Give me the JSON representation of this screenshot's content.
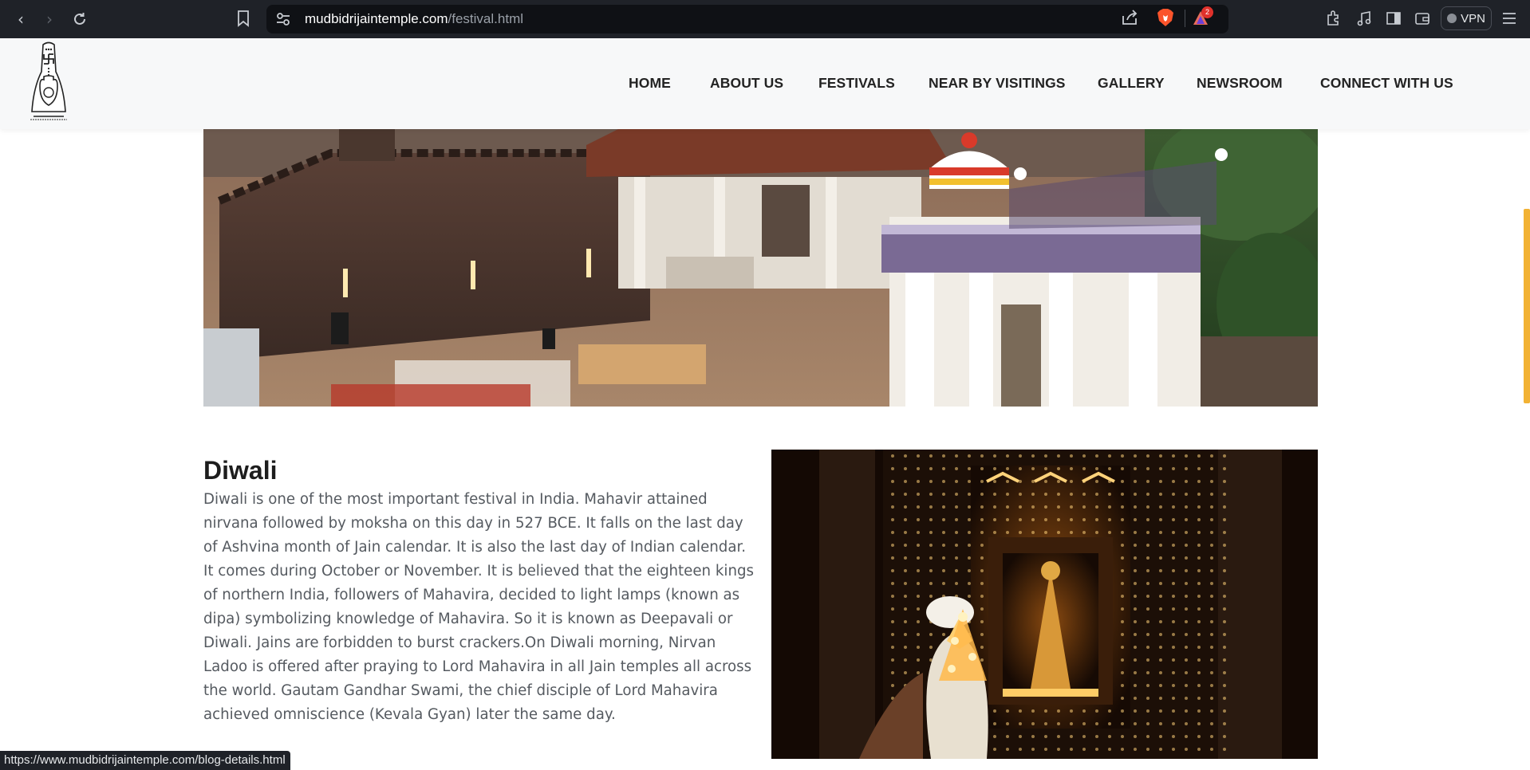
{
  "browser": {
    "url_domain": "mudbidrijaintemple.com",
    "url_path": "/festival.html",
    "rewards_count": "2",
    "vpn_label": "VPN",
    "status_url": "https://www.mudbidrijaintemple.com/blog-details.html"
  },
  "nav": {
    "items": [
      {
        "label": "HOME"
      },
      {
        "label": "ABOUT US"
      },
      {
        "label": "FESTIVALS"
      },
      {
        "label": "NEAR BY VISITINGS"
      },
      {
        "label": "GALLERY"
      },
      {
        "label": "NEWSROOM"
      },
      {
        "label": "CONNECT WITH US"
      }
    ]
  },
  "festival": {
    "title": "Diwali",
    "body": "Diwali is one of the most important festival in India. Mahavir attained nirvana followed by moksha on this day in 527 BCE. It falls on the last day of Ashvina month of Jain calendar. It is also the last day of Indian calendar. It comes during October or November. It is believed that the eighteen kings of northern India, followers of Mahavira, decided to light lamps (known as dipa) symbolizing knowledge of Mahavira. So it is known as Deepavali or Diwali. Jains are forbidden to burst crackers.On Diwali morning, Nirvan Ladoo is offered after praying to Lord Mahavira in all Jain temples all across the world. Gautam Gandhar Swami, the chief disciple of Lord Mahavira achieved omniscience (Kevala Gyan) later the same day."
  },
  "colors": {
    "browser_bg": "#1f2228",
    "header_bg": "#f7f8f9",
    "scroll_accent": "#f2b234",
    "badge_red": "#e0312b"
  }
}
